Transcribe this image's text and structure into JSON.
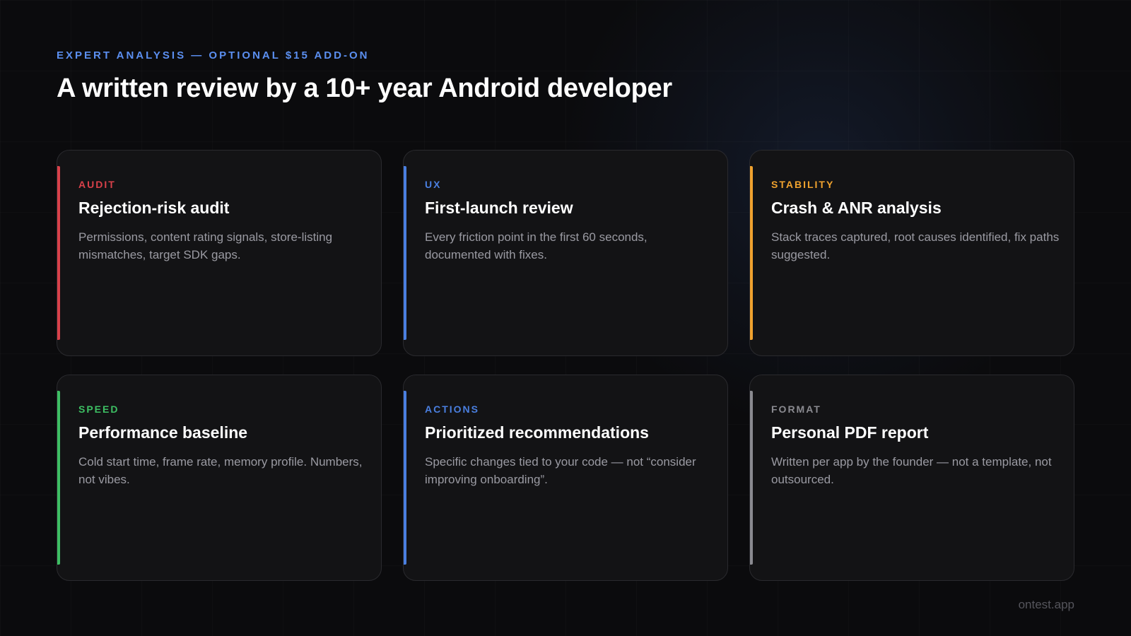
{
  "header": {
    "eyebrow": "EXPERT ANALYSIS — OPTIONAL $15 ADD-ON",
    "title": "A written review by a 10+ year Android developer"
  },
  "cards": [
    {
      "tag": "AUDIT",
      "title": "Rejection-risk audit",
      "description": "Permissions, content rating signals, store-listing mismatches, target SDK gaps.",
      "accent_color": "#d9414a"
    },
    {
      "tag": "UX",
      "title": "First-launch review",
      "description": "Every friction point in the first 60 seconds, documented with fixes.",
      "accent_color": "#4a7fe0"
    },
    {
      "tag": "STABILITY",
      "title": "Crash & ANR analysis",
      "description": "Stack traces captured, root causes identified, fix paths suggested.",
      "accent_color": "#f0a22e"
    },
    {
      "tag": "SPEED",
      "title": "Performance baseline",
      "description": "Cold start time, frame rate, memory profile. Numbers, not vibes.",
      "accent_color": "#3dbf63"
    },
    {
      "tag": "ACTIONS",
      "title": "Prioritized recommendations",
      "description": "Specific changes tied to your code — not “consider improving onboarding”.",
      "accent_color": "#4a7fe0"
    },
    {
      "tag": "FORMAT",
      "title": "Personal PDF report",
      "description": "Written per app by the founder — not a template, not outsourced.",
      "accent_color": "#8a8a90"
    }
  ],
  "footer": {
    "brand": "ontest.app"
  },
  "colors": {
    "background": "#0b0b0d",
    "card_background": "#131315",
    "eyebrow": "#5b8ff0"
  }
}
